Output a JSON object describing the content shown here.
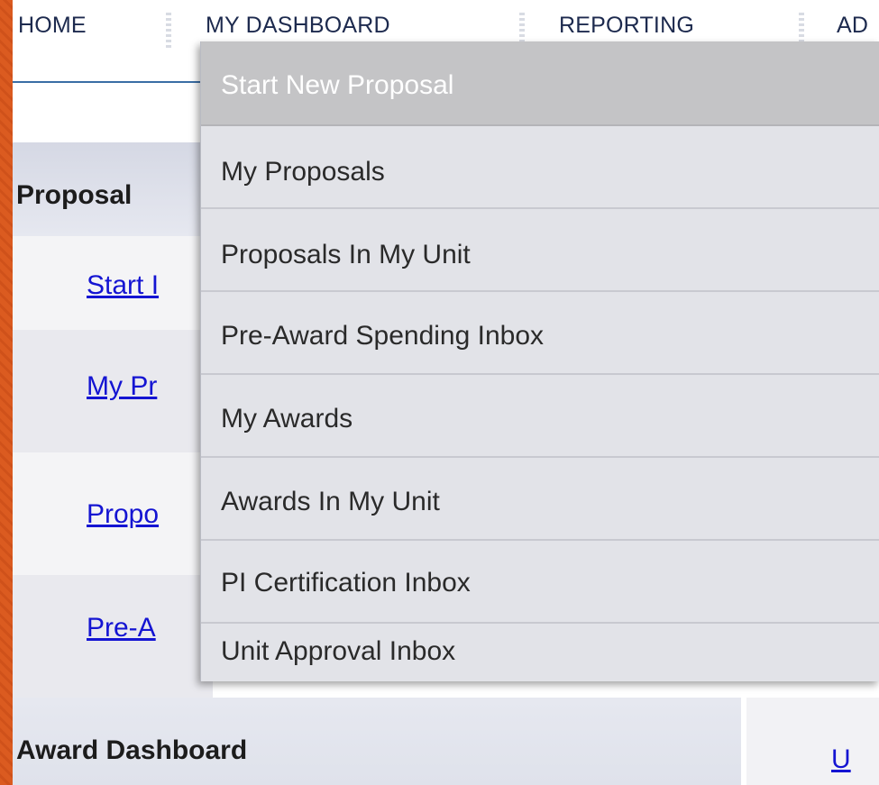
{
  "nav": {
    "items": [
      "HOME",
      "MY DASHBOARD",
      "REPORTING",
      "AD"
    ]
  },
  "dashboard": {
    "proposal_header": "Proposal",
    "links": [
      "Start I",
      "My Pr",
      "Propo",
      "Pre-A"
    ],
    "award_header": "Award Dashboard",
    "right_link": "U"
  },
  "dropdown": {
    "items": [
      "Start New Proposal",
      "My Proposals",
      "Proposals In My Unit",
      "Pre-Award Spending Inbox",
      "My Awards",
      "Awards In My Unit",
      "PI Certification Inbox",
      "Unit Approval Inbox"
    ],
    "active_index": 0
  },
  "colors": {
    "frame": "#d9581e",
    "link": "#1414d2",
    "menu_bg": "#e2e3e8",
    "menu_active": "#c4c4c6"
  }
}
